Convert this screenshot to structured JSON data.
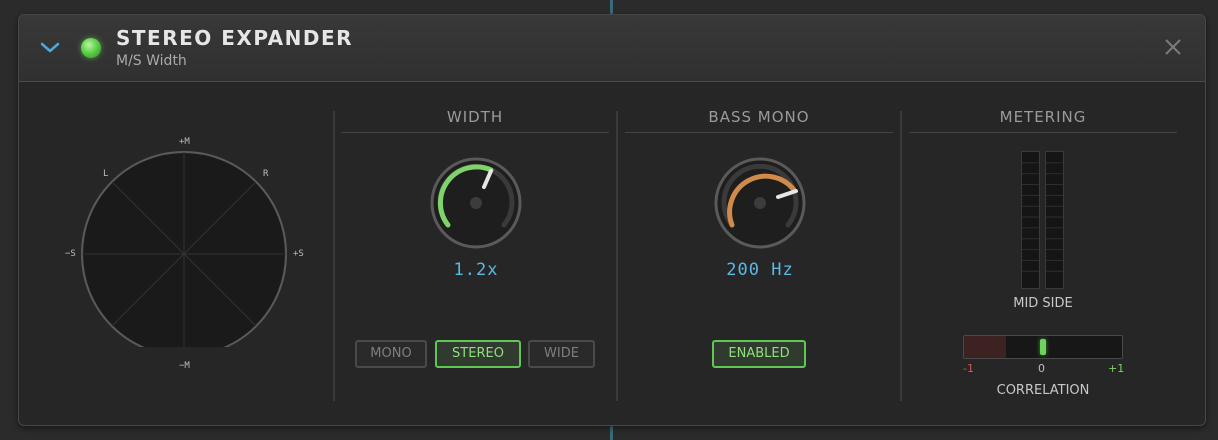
{
  "plugin": {
    "title": "STEREO EXPANDER",
    "subtitle": "M/S Width",
    "power_on": true
  },
  "vectorscope": {
    "labels": {
      "top": "+M",
      "bottom": "−M",
      "left": "−S",
      "right": "+S",
      "upper_left": "L",
      "upper_right": "R"
    }
  },
  "width": {
    "title": "WIDTH",
    "value": "1.2x",
    "modes": [
      "MONO",
      "STEREO",
      "WIDE"
    ],
    "active_mode": "STEREO",
    "knob_color": "#7ed36a"
  },
  "bass_mono": {
    "title": "BASS MONO",
    "value": "200 Hz",
    "toggle_label": "ENABLED",
    "enabled": true,
    "knob_color": "#d08a4a"
  },
  "metering": {
    "title": "METERING",
    "meter_label": "MID SIDE",
    "correlation": {
      "label": "CORRELATION",
      "min": "-1",
      "mid": "0",
      "max": "+1",
      "value": 0.05
    }
  },
  "colors": {
    "accent_value": "#5ab8e6",
    "active_green": "#5fc752",
    "negative_red": "#d25a4a"
  }
}
